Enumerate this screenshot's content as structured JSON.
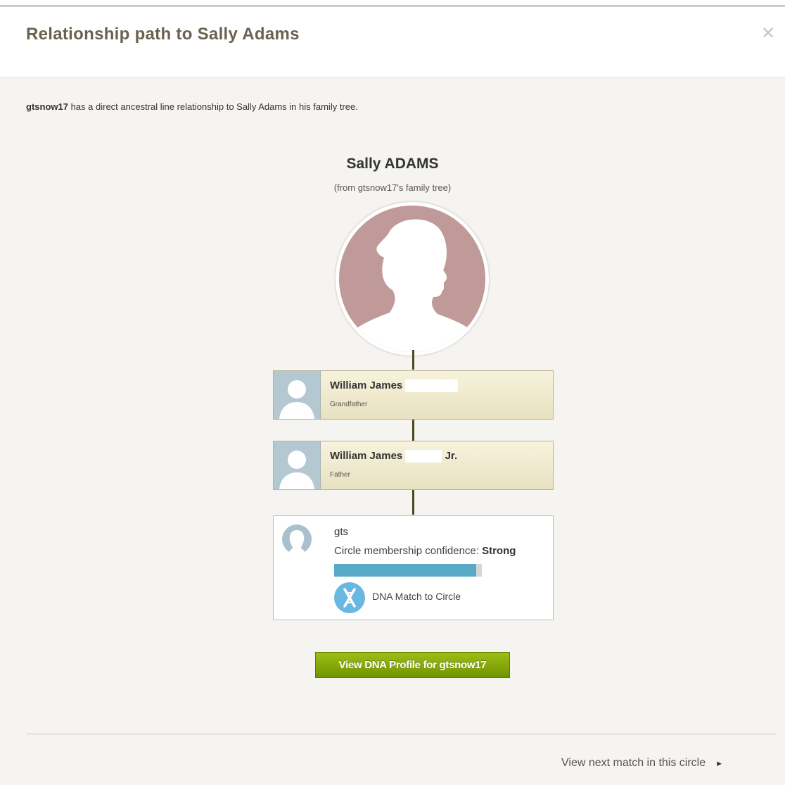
{
  "dialog": {
    "title": "Relationship path to Sally Adams",
    "close_glyph": "✕",
    "intro_user": "gtsnow17",
    "intro_text": " has a direct ancestral line relationship to Sally Adams in his family tree."
  },
  "ancestor": {
    "name": "Sally ADAMS",
    "source": "(from gtsnow17's family tree)",
    "avatar_color": "#c09a98"
  },
  "path": [
    {
      "name": "William James ",
      "suffix": "",
      "role": "Grandfather"
    },
    {
      "name": "William James ",
      "suffix": " Jr.",
      "role": "Father"
    }
  ],
  "match": {
    "name": "gts",
    "confidence_label": "Circle membership confidence: ",
    "confidence_value": "Strong",
    "confidence_level": 0.96,
    "dna_label": "DNA Match to Circle"
  },
  "actions": {
    "view_profile": "View DNA Profile for gtsnow17",
    "next_match": "View next match in this circle",
    "next_arrow": "►"
  },
  "colors": {
    "button": "#7fa30a",
    "bar": "#57abc8",
    "dna_icon": "#69b8e2"
  }
}
